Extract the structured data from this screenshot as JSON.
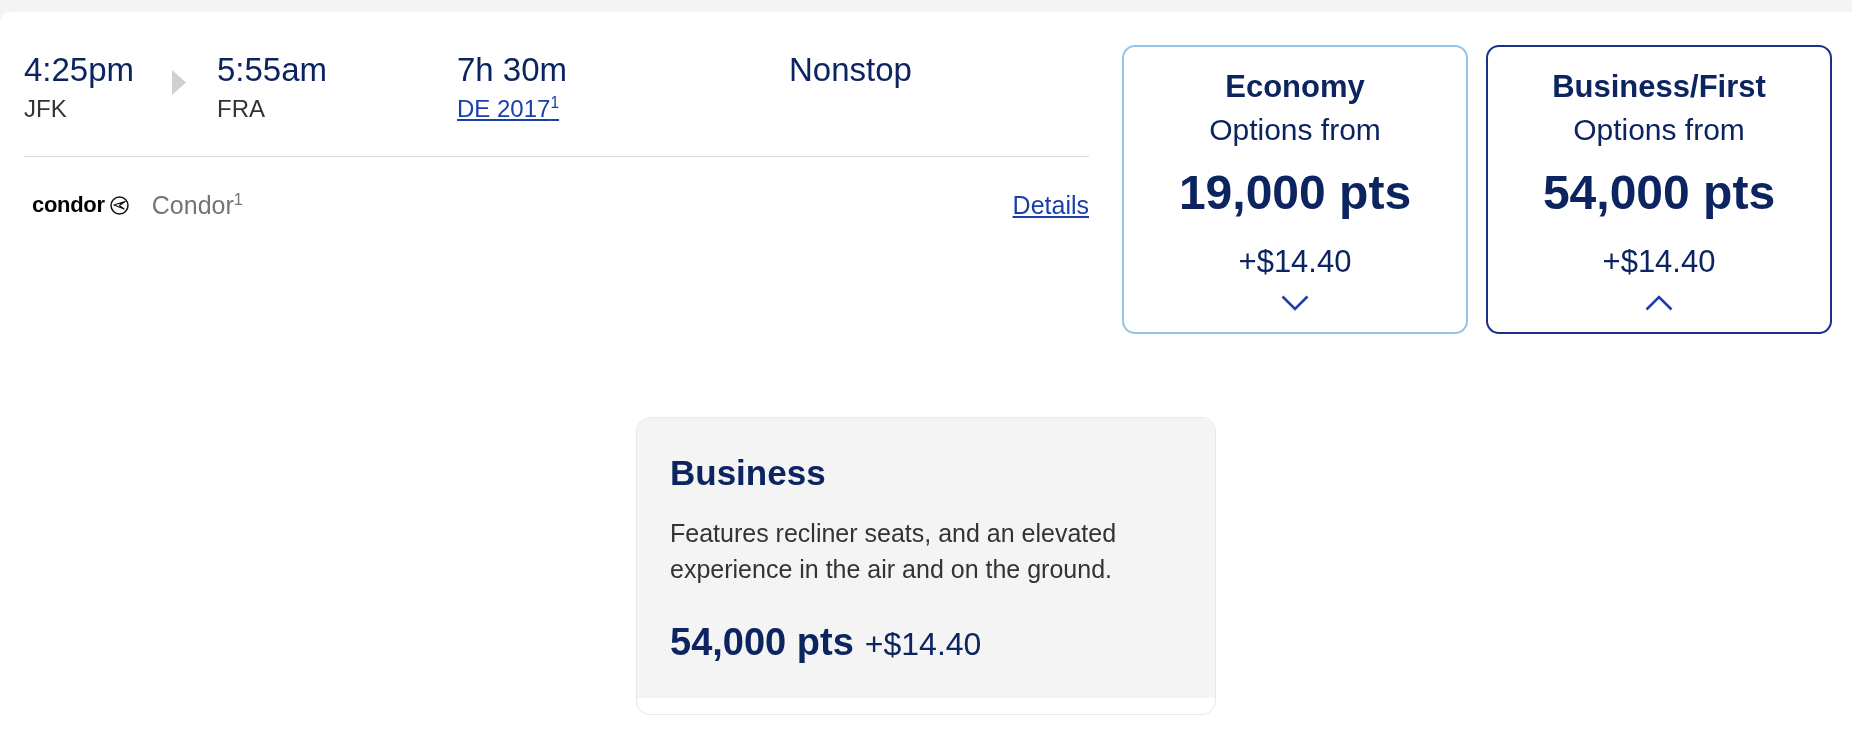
{
  "flight": {
    "depart_time": "4:25pm",
    "depart_airport": "JFK",
    "arrive_time": "5:55am",
    "arrive_airport": "FRA",
    "duration": "7h 30m",
    "flight_number": "DE 2017$^{1}$",
    "stops": "Nonstop"
  },
  "carrier": {
    "logo_text": "condor",
    "name": "Condor$^{1}$",
    "details_link": "Details"
  },
  "fares": [
    {
      "cabin": "Economy",
      "label": "Options from",
      "points": "19,000 pts",
      "fee": "+$14.40",
      "expanded": false
    },
    {
      "cabin": "Business/First",
      "label": "Options from",
      "points": "54,000 pts",
      "fee": "+$14.40",
      "expanded": true
    }
  ],
  "fare_detail": {
    "cabin": "Business",
    "description": "Features recliner seats, and an elevated experience in the air and on the ground.",
    "points": "54,000 pts",
    "fee": "+$14.40"
  }
}
